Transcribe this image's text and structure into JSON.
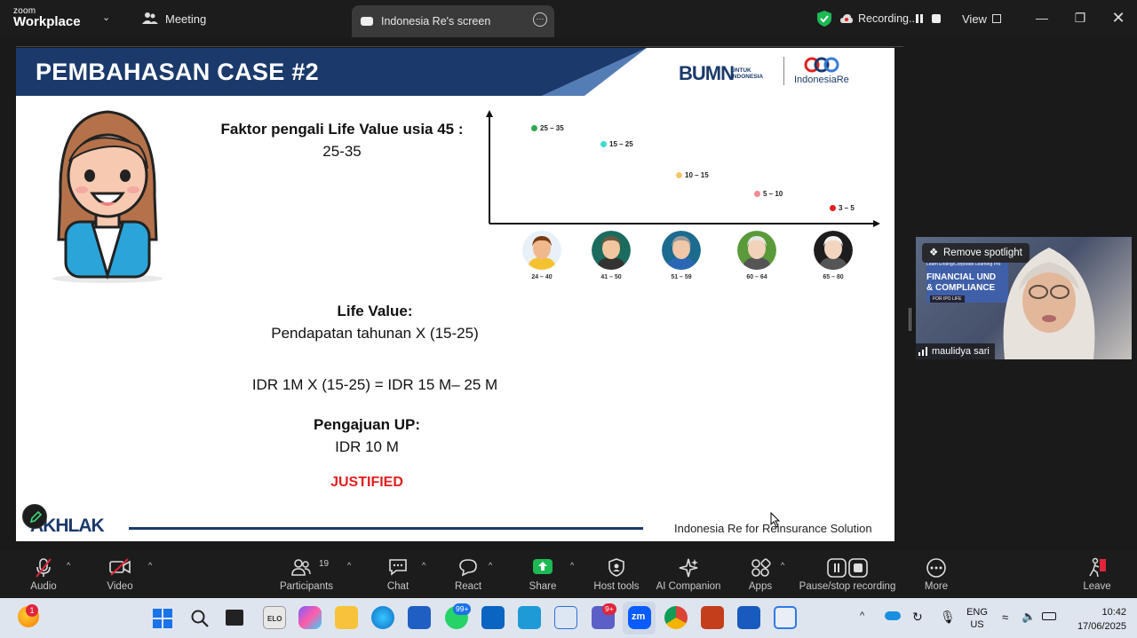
{
  "app": {
    "brand_small": "zoom",
    "brand_big": "Workplace"
  },
  "titlebar": {
    "meeting_label": "Meeting",
    "share_tab_label": "Indonesia Re's screen",
    "recording_label": "Recording...",
    "view_label": "View"
  },
  "slide": {
    "title": "PEMBAHASAN CASE #2",
    "logo_bumn": "BUMN",
    "logo_bumn_sub1": "UNTUK",
    "logo_bumn_sub2": "INDONESIA",
    "logo_indonesiare": "IndonesiaRe",
    "faktor_heading": "Faktor pengali Life Value usia 45 :",
    "faktor_value": "25-35",
    "chart": {
      "points": [
        {
          "label": "25 – 35",
          "color": "#2fa84f"
        },
        {
          "label": "15 – 25",
          "color": "#3fd9d0"
        },
        {
          "label": "10 – 15",
          "color": "#f5c66b"
        },
        {
          "label": "5 – 10",
          "color": "#f28a93"
        },
        {
          "label": "3 – 5",
          "color": "#e02020"
        }
      ],
      "age_groups": [
        "24 – 40",
        "41 – 50",
        "51 – 59",
        "60 – 64",
        "65 – 80"
      ]
    },
    "life_value_heading": "Life Value:",
    "life_value_text": "Pendapatan tahunan X (15-25)",
    "calc_text": "IDR 1M X (15-25) = IDR 15 M– 25 M",
    "pengajuan_heading": "Pengajuan UP:",
    "pengajuan_value": "IDR 10 M",
    "justified": "JUSTIFIED",
    "akhlak": "AKHLAK",
    "footer": "Indonesia Re for Reinsurance Solution"
  },
  "video": {
    "remove_spotlight": "Remove spotlight",
    "participant_name": "maulidya sari",
    "bg_text1": "Learn Ending/Corporate Learning Pro",
    "bg_text2": "FINANCIAL UND",
    "bg_text3": "& COMPLIANCE",
    "bg_text4": "FOR IPO LIFE"
  },
  "toolbar": {
    "audio": "Audio",
    "video": "Video",
    "participants": "Participants",
    "participants_count": "19",
    "chat": "Chat",
    "react": "React",
    "share": "Share",
    "host_tools": "Host tools",
    "ai_companion": "AI Companion",
    "apps": "Apps",
    "pause_stop": "Pause/stop recording",
    "more": "More",
    "leave": "Leave"
  },
  "taskbar": {
    "lang1": "ENG",
    "lang2": "US",
    "time": "10:42",
    "date": "17/06/2025",
    "whatsapp_badge": "99+",
    "teams_badge": "9+",
    "app_badge": "1",
    "elo_label": "ELO"
  },
  "colors": {
    "zoom_blue": "#0b5cff",
    "share_green": "#1db954",
    "slide_navy": "#1b3a6b",
    "justified_red": "#e02020"
  }
}
